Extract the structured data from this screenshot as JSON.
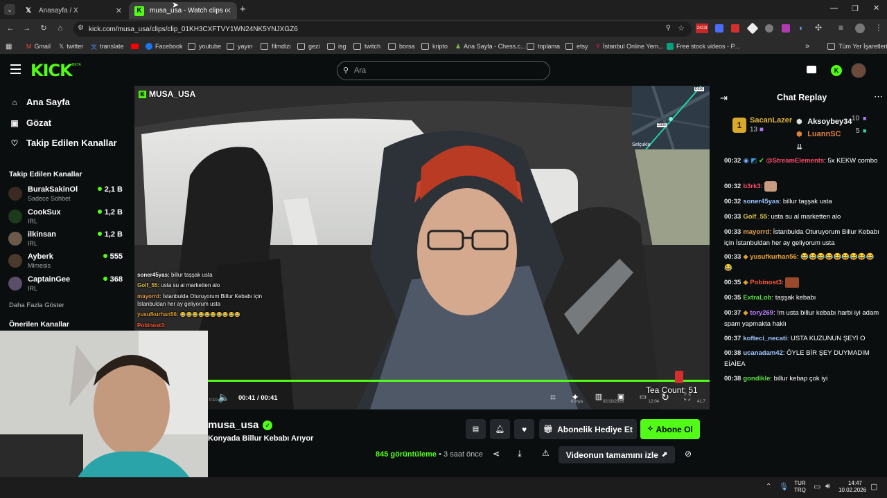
{
  "browser": {
    "tabs": [
      {
        "title": "Anasayfa / X",
        "icon": "x-logo-icon",
        "active": false
      },
      {
        "title": "musa_usa - Watch clips on Kick",
        "icon": "kick-logo-icon",
        "active": true
      }
    ],
    "new_tab_symbol": "+",
    "url": "kick.com/musa_usa/clips/clip_01KH3CXFTVY1WN24NK5YNJXGZ6",
    "extension_badge": "2423t",
    "bookmarks": [
      "Gmail",
      "twitter",
      "translate",
      "",
      "Facebook",
      "youtube",
      "yayın",
      "filmdizi",
      "gezi",
      "isg",
      "twitch",
      "borsa",
      "kripto",
      "Ana Sayfa - Chess.c...",
      "toplama",
      "etsy",
      "İstanbul Online Yem...",
      "Free stock videos - P..."
    ],
    "all_bookmarks": "Tüm Yer İşaretleri",
    "chevron": "»"
  },
  "kick": {
    "logo": "KICK",
    "logo_beta": "BETA",
    "search_placeholder": "Ara",
    "nav": [
      {
        "label": "Ana Sayfa",
        "icon": "home-icon"
      },
      {
        "label": "Gözat",
        "icon": "browse-icon"
      },
      {
        "label": "Takip Edilen Kanallar",
        "icon": "heart-icon"
      }
    ],
    "followed_title": "Takip Edilen Kanallar",
    "channels": [
      {
        "name": "BurakSakinOl",
        "category": "Sadece Sohbet",
        "viewers": "2,1 B",
        "color": "#3a2a22"
      },
      {
        "name": "CookSux",
        "category": "IRL",
        "viewers": "1,2 B",
        "color": "#1b3b1b"
      },
      {
        "name": "ilkinsan",
        "category": "IRL",
        "viewers": "1,2 B",
        "color": "#6b5a4a"
      },
      {
        "name": "Ayberk",
        "category": "Mimesis",
        "viewers": "555",
        "color": "#4a3a2e"
      },
      {
        "name": "CaptainGee",
        "category": "IRL",
        "viewers": "368",
        "color": "#5a4e6a"
      }
    ],
    "show_more": "Daha Fazla Göster",
    "recommended_title": "Önerilen Kanallar"
  },
  "video": {
    "channel_tag": "MUSA_USA",
    "minimap_label_1": "D336",
    "minimap_label_2": "D336",
    "minimap_place": "Selçuklu",
    "overlay_chat": [
      {
        "user": "soner45yas:",
        "text": "billur taşşak usta",
        "color": "#ffffff"
      },
      {
        "user": "Golf_55:",
        "text": "usta su al marketten alo",
        "color": "#d6c04a"
      },
      {
        "user": "mayorrd:",
        "text": "İstanbulda Oturuyorum Billur Kebabı için",
        "color": "#e8a050"
      },
      {
        "user": "",
        "text": "İstanbuldan her ay geliyorum usta",
        "color": "#ffffff"
      },
      {
        "user": "yusufkurhan56:",
        "text": "😂😂😂😂😂😂😂😂😂😂",
        "color": "#e0a030"
      },
      {
        "user": "Pobinost3:",
        "text": "",
        "color": "#ff5a3a"
      },
      {
        "user": "",
        "text": "kebabı harbi iyi adam spam",
        "color": "#ffffff"
      },
      {
        "user": "",
        "text": "UNUN ŞEYİ O",
        "color": "#ffffff"
      },
      {
        "user": "",
        "text": "EY DUYMADIM EİAİEA",
        "color": "#ffffff"
      },
      {
        "user": "",
        "text": "iyi",
        "color": "#ffffff"
      }
    ],
    "time_current": "00:41",
    "time_sep": "/",
    "time_total": "00:41",
    "time_left": "0:10",
    "tea_count": "Tea Count: 51",
    "dash_city": "Konya",
    "dash_date": "02/10/2026",
    "dash_time": "12:04",
    "dash_extra": "41.7",
    "progress": 1.0
  },
  "below_video": {
    "channel_name": "musa_usa",
    "clip_title": "Konyada Billur Kebabı Arıyor",
    "views_count": "845",
    "views_label": "görüntüleme",
    "dot": "•",
    "time_ago": "3 saat önce",
    "gift_sub": "Abonelik Hediye Et",
    "subscribe": "Abone Ol",
    "watch_full": "Videonun tamamını izle"
  },
  "chat": {
    "title": "Chat Replay",
    "top_gifters": [
      {
        "rank": "1",
        "name": "SacanLazer",
        "count": "13"
      },
      {
        "rank": "",
        "name": "Aksoybey34",
        "count": "10"
      },
      {
        "rank": "",
        "name": "LuannSC",
        "count": "5"
      }
    ],
    "messages": [
      {
        "time": "00:32",
        "user": "@StreamElements",
        "sep": ":",
        "text": "5x KEKW combo",
        "color": "#ff4a6a"
      },
      {
        "time": "00:32",
        "user": "b3rk3",
        "sep": ":",
        "text": "",
        "color": "#ff4a6a"
      },
      {
        "time": "00:32",
        "user": "soner45yas",
        "sep": ":",
        "text": "billur taşşak usta",
        "color": "#9fc3ff"
      },
      {
        "time": "00:33",
        "user": "Golf_55",
        "sep": ":",
        "text": "usta su al marketten alo",
        "color": "#d6c04a"
      },
      {
        "time": "00:33",
        "user": "mayorrd",
        "sep": ":",
        "text": "İstanbulda Oturuyorum Billur Kebabı için İstanbuldan her ay geliyorum usta",
        "color": "#e8a050"
      },
      {
        "time": "00:33",
        "user": "yusufkurhan56",
        "sep": ":",
        "text": "😂😂😂😂😂😂😂😂😂😂",
        "color": "#f0a13a"
      },
      {
        "time": "00:35",
        "user": "Pobinost3",
        "sep": ":",
        "text": "",
        "color": "#ff5a3a"
      },
      {
        "time": "00:35",
        "user": "ExtraLob",
        "sep": ":",
        "text": "taşşak kebabı",
        "color": "#58e040"
      },
      {
        "time": "00:37",
        "user": "tory269",
        "sep": ":",
        "text": "!m usta billur kebabı harbi iyi adam spam yapmakta haklı",
        "color": "#c080ff"
      },
      {
        "time": "00:37",
        "user": "kofteci_necati",
        "sep": ":",
        "text": "USTA KUZUNUN ŞEYİ O",
        "color": "#9fc3ff"
      },
      {
        "time": "00:38",
        "user": "ucanadam42",
        "sep": ":",
        "text": "ÖYLE BİR ŞEY DUYMADIM EİAİEA",
        "color": "#9fc3ff"
      },
      {
        "time": "00:38",
        "user": "gondikle",
        "sep": ":",
        "text": "billur kebap çok iyi",
        "color": "#58e040"
      }
    ]
  },
  "taskbar": {
    "lang_1": "TUR",
    "lang_2": "TRQ",
    "clock_time": "14:47",
    "clock_date": "10.02.2026"
  },
  "colors": {
    "kick_green": "#53fc18",
    "bg": "#0b0e0f"
  }
}
